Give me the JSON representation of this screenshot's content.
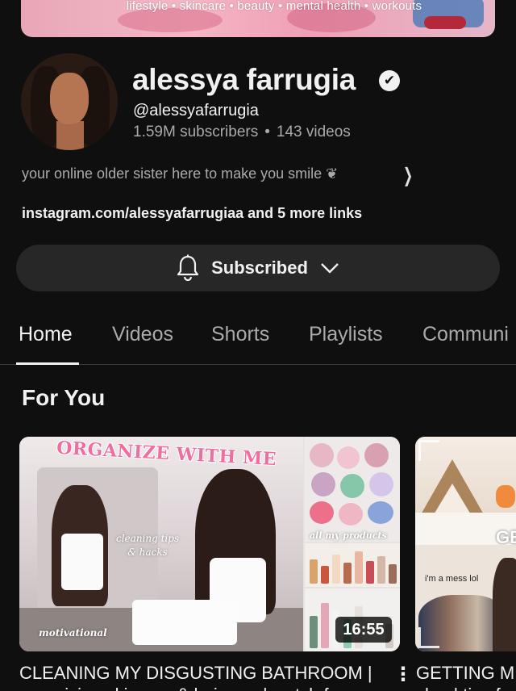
{
  "banner": {
    "text": "lifestyle • skincare • beauty • mental health • workouts"
  },
  "channel": {
    "name": "alessya farrugia",
    "verified_icon": "✔",
    "handle": "@alessyafarrugia",
    "subscribers": "1.59M subscribers",
    "separator": "•",
    "videos": "143 videos",
    "description": "your online older sister here to make you smile ❦",
    "links": "instagram.com/alessyafarrugiaa and 5 more links"
  },
  "subscribe": {
    "label": "Subscribed",
    "icon": "bell-icon",
    "chevron": "chevron-down-icon"
  },
  "tabs": [
    {
      "label": "Home",
      "active": true
    },
    {
      "label": "Videos"
    },
    {
      "label": "Shorts"
    },
    {
      "label": "Playlists"
    },
    {
      "label": "Communi"
    }
  ],
  "section": {
    "title": "For You"
  },
  "videos": [
    {
      "thumb_headline": "ORGANIZE WITH ME",
      "thumb_cleaning_l1": "cleaning tips",
      "thumb_cleaning_l2": "& hacks",
      "thumb_motivational": "motivational",
      "thumb_products": "all my products",
      "duration": "16:55",
      "title_line1": "CLEANING MY DISGUSTING BATHROOM |",
      "title_line2": "organizing skincare & haircare | watch fo",
      "menu": "⋮"
    },
    {
      "thumb_label": "i'm a mess lol",
      "thumb_ge": "GE",
      "title_line1": "GETTING M",
      "title_line2": "vlog | tips f"
    }
  ]
}
